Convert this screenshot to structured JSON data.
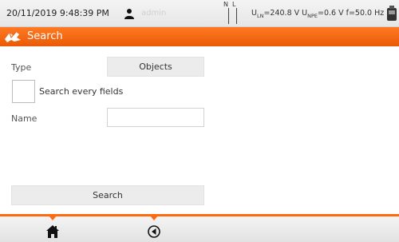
{
  "status_bar": {
    "datetime": "20/11/2019 9:48:39 PM",
    "user": "admin",
    "phase_n": "N",
    "phase_l": "L",
    "u_ln_label": "U",
    "u_ln_sub": "LN",
    "u_ln_value": "=240.8 V ",
    "u_npe_label": "U",
    "u_npe_sub": "NPE",
    "u_npe_value": "=0.6 V f=50.0 Hz"
  },
  "title_bar": {
    "title": "Search"
  },
  "form": {
    "type_label": "Type",
    "type_value": "Objects",
    "search_every_label": "Search every fields",
    "name_label": "Name",
    "name_value": "",
    "search_button": "Search"
  },
  "colors": {
    "accent": "#ff6a10",
    "button": "#ececec"
  },
  "icons": [
    "user-icon",
    "device-icon",
    "search-wing-icon",
    "home-icon",
    "back-icon"
  ]
}
